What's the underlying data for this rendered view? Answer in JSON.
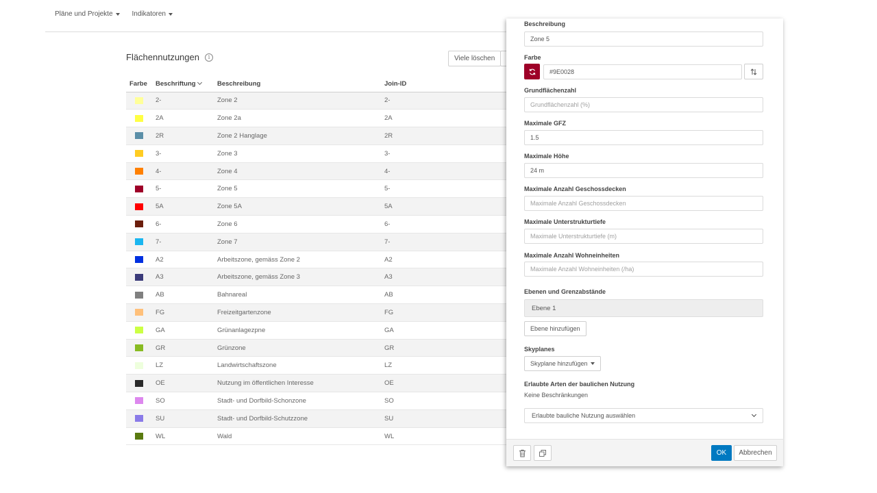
{
  "nav": {
    "items": [
      "Pläne und Projekte",
      "Indikatoren"
    ]
  },
  "list": {
    "title": "Flächennutzungen",
    "delete_many_label": "Viele löschen",
    "columns": {
      "color": "Farbe",
      "label": "Beschriftung",
      "desc": "Beschreibung",
      "join": "Join-ID"
    },
    "rows": [
      {
        "color": "#FFFF99",
        "label": "2-",
        "desc": "Zone 2",
        "join": "2-"
      },
      {
        "color": "#FFFF44",
        "label": "2A",
        "desc": "Zone 2a",
        "join": "2A"
      },
      {
        "color": "#5B8FA8",
        "label": "2R",
        "desc": "Zone 2 Hanglage",
        "join": "2R"
      },
      {
        "color": "#FFCC22",
        "label": "3-",
        "desc": "Zone 3",
        "join": "3-"
      },
      {
        "color": "#FF8000",
        "label": "4-",
        "desc": "Zone 4",
        "join": "4-"
      },
      {
        "color": "#9E0028",
        "label": "5-",
        "desc": "Zone 5",
        "join": "5-"
      },
      {
        "color": "#FF0000",
        "label": "5A",
        "desc": "Zone 5A",
        "join": "5A"
      },
      {
        "color": "#6B1E0C",
        "label": "6-",
        "desc": "Zone 6",
        "join": "6-"
      },
      {
        "color": "#1AB6F0",
        "label": "7-",
        "desc": "Zone 7",
        "join": "7-"
      },
      {
        "color": "#0030E0",
        "label": "A2",
        "desc": "Arbeitszone, gemäss Zone 2",
        "join": "A2"
      },
      {
        "color": "#3B3B7A",
        "label": "A3",
        "desc": "Arbeitszone, gemäss Zone 3",
        "join": "A3"
      },
      {
        "color": "#808080",
        "label": "AB",
        "desc": "Bahnareal",
        "join": "AB"
      },
      {
        "color": "#FFC07A",
        "label": "FG",
        "desc": "Freizeitgartenzone",
        "join": "FG"
      },
      {
        "color": "#CCFF44",
        "label": "GA",
        "desc": "Grünanlagezpne",
        "join": "GA"
      },
      {
        "color": "#88BB22",
        "label": "GR",
        "desc": "Grünzone",
        "join": "GR"
      },
      {
        "color": "#EEFFDD",
        "label": "LZ",
        "desc": "Landwirtschaftszone",
        "join": "LZ"
      },
      {
        "color": "#2A2A2A",
        "label": "OE",
        "desc": "Nutzung im öffentlichen Interesse",
        "join": "OE"
      },
      {
        "color": "#DD88EE",
        "label": "SO",
        "desc": "Stadt- und Dorfbild-Schonzone",
        "join": "SO"
      },
      {
        "color": "#8A7BE8",
        "label": "SU",
        "desc": "Stadt- und Dorfbild-Schutzzone",
        "join": "SU"
      },
      {
        "color": "#5A7A10",
        "label": "WL",
        "desc": "Wald",
        "join": "WL"
      }
    ]
  },
  "panel": {
    "beschreibung": {
      "label": "Beschreibung",
      "value": "Zone 5"
    },
    "farbe": {
      "label": "Farbe",
      "value": "#9E0028",
      "swatch": "#9E0028"
    },
    "grundflaechenzahl": {
      "label": "Grundflächenzahl",
      "placeholder": "Grundflächenzahl (%)"
    },
    "max_gfz": {
      "label": "Maximale GFZ",
      "value": "1.5"
    },
    "max_hoehe": {
      "label": "Maximale Höhe",
      "value": "24 m"
    },
    "max_geschossdecken": {
      "label": "Maximale Anzahl Geschossdecken",
      "placeholder": "Maximale Anzahl Geschossdecken"
    },
    "max_unterstruktur": {
      "label": "Maximale Unterstrukturtiefe",
      "placeholder": "Maximale Unterstrukturtiefe (m)"
    },
    "max_wohneinheiten": {
      "label": "Maximale Anzahl Wohneinheiten",
      "placeholder": "Maximale Anzahl Wohneinheiten (/ha)"
    },
    "ebenen": {
      "label": "Ebenen und Grenzabstände",
      "item": "Ebene 1",
      "add_label": "Ebene hinzufügen"
    },
    "skyplanes": {
      "label": "Skyplanes",
      "add_label": "Skyplane hinzufügen"
    },
    "nutzung": {
      "label": "Erlaubte Arten der baulichen Nutzung",
      "status": "Keine Beschränkungen",
      "select": "Erlaubte bauliche Nutzung auswählen"
    },
    "ok_label": "OK",
    "cancel_label": "Abbrechen"
  }
}
